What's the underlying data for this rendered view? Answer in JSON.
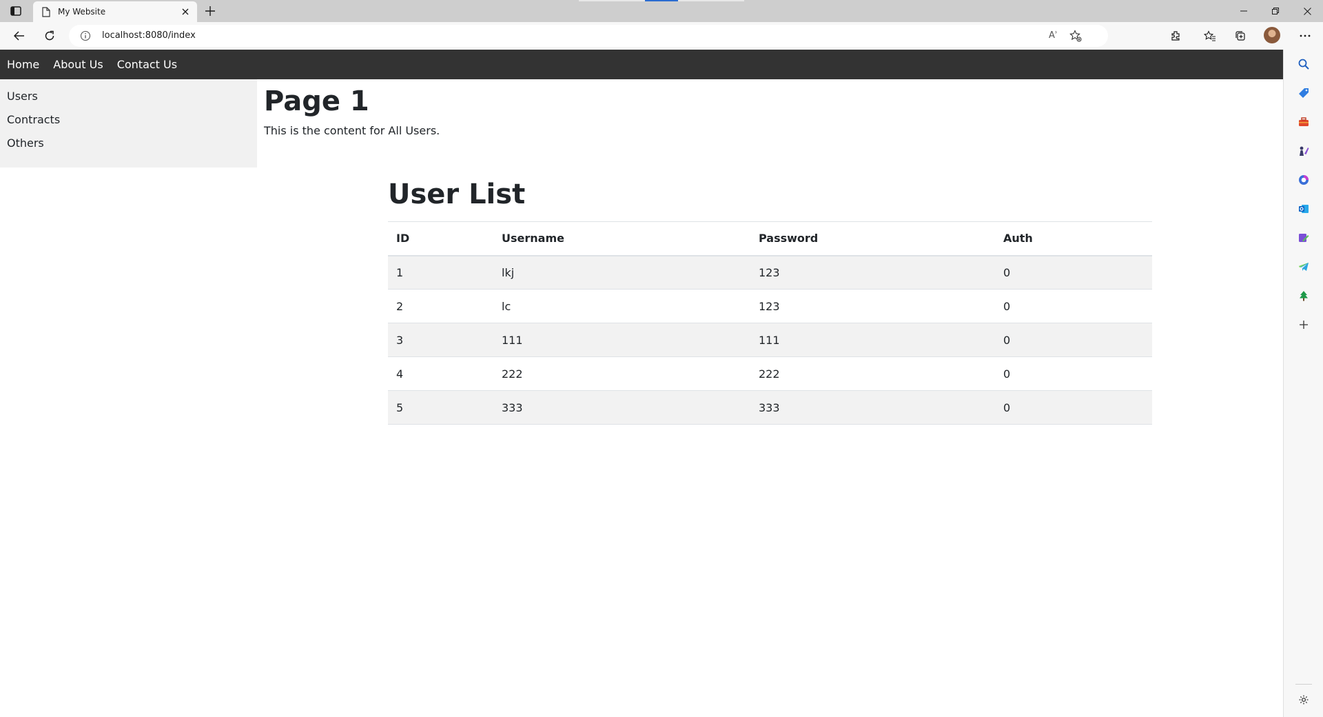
{
  "browser": {
    "tab_title": "My Website",
    "url": "localhost:8080/index",
    "read_aloud_glyph": "Aʾ"
  },
  "site": {
    "nav": [
      "Home",
      "About Us",
      "Contact Us"
    ],
    "side_menu": [
      "Users",
      "Contracts",
      "Others"
    ],
    "page_title": "Page 1",
    "page_text": "This is the content for All Users.",
    "list_title": "User List",
    "table": {
      "headers": [
        "ID",
        "Username",
        "Password",
        "Auth"
      ],
      "rows": [
        [
          "1",
          "lkj",
          "123",
          "0"
        ],
        [
          "2",
          "lc",
          "123",
          "0"
        ],
        [
          "3",
          "111",
          "111",
          "0"
        ],
        [
          "4",
          "222",
          "222",
          "0"
        ],
        [
          "5",
          "333",
          "333",
          "0"
        ]
      ]
    }
  },
  "edge_sidebar_icons": [
    "search-icon",
    "shopping-tag-icon",
    "tools-icon",
    "games-icon",
    "office-icon",
    "outlook-icon",
    "designer-icon",
    "telegram-icon",
    "tree-icon",
    "add-icon",
    "settings-icon"
  ],
  "colors": {
    "site_nav_bg": "#333333",
    "side_menu_bg": "#f1f1f1",
    "row_stripe": "#f2f2f2",
    "tab_progress": "#2b6cd1"
  }
}
